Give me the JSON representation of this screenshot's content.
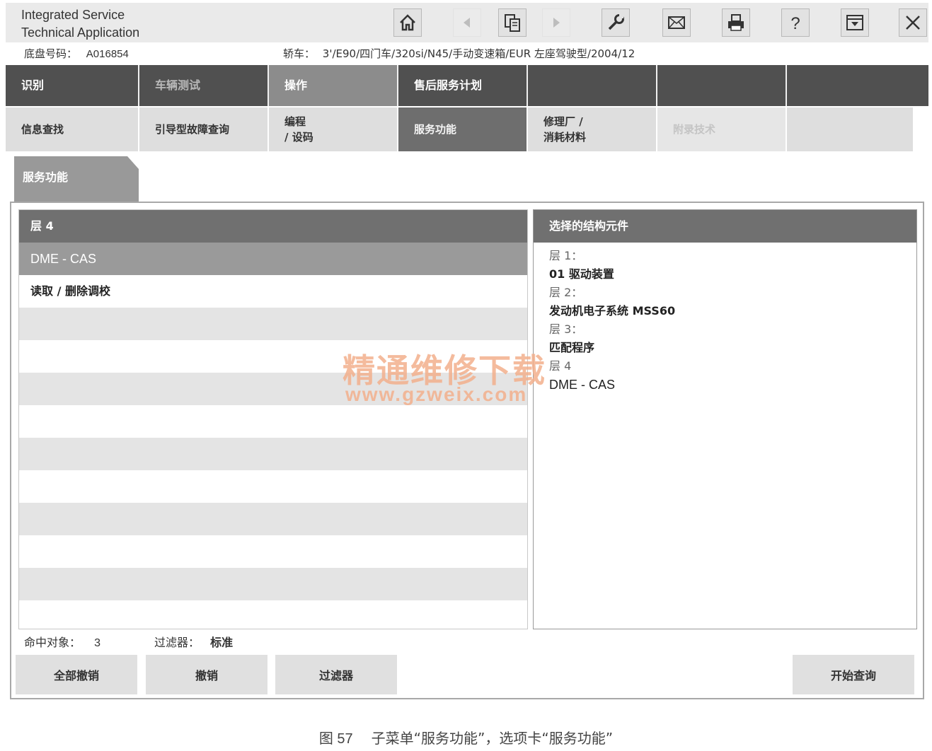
{
  "app": {
    "title_line1": "Integrated Service",
    "title_line2": "Technical Application"
  },
  "toolbar": [
    {
      "name": "home-icon",
      "enabled": true
    },
    {
      "name": "back-icon",
      "enabled": false
    },
    {
      "name": "document-icon",
      "enabled": true
    },
    {
      "name": "forward-icon",
      "enabled": false
    },
    {
      "name": "wrench-icon",
      "enabled": true
    },
    {
      "name": "mail-icon",
      "enabled": true
    },
    {
      "name": "print-icon",
      "enabled": true
    },
    {
      "name": "help-icon",
      "enabled": true
    },
    {
      "name": "minimize-icon",
      "enabled": true
    },
    {
      "name": "close-icon",
      "enabled": true
    }
  ],
  "info": {
    "chassis_label": "底盘号码：",
    "chassis_value": "A016854",
    "vehicle_label": "轿车：",
    "vehicle_value": "3'/E90/四门车/320si/N45/手动变速箱/EUR 左座驾驶型/2004/12"
  },
  "main_tabs": [
    {
      "label": "识别",
      "state": "normal"
    },
    {
      "label": "车辆测试",
      "state": "muted"
    },
    {
      "label": "操作",
      "state": "active"
    },
    {
      "label": "售后服务计划",
      "state": "normal"
    },
    {
      "label": "",
      "state": "normal"
    },
    {
      "label": "",
      "state": "normal"
    },
    {
      "label": "",
      "state": "normal"
    }
  ],
  "sub_tabs": [
    {
      "label": "信息查找",
      "state": "normal"
    },
    {
      "label": "引导型故障查询",
      "state": "normal"
    },
    {
      "label": "编程\n/ 设码",
      "state": "normal"
    },
    {
      "label": "服务功能",
      "state": "active"
    },
    {
      "label": "修理厂 /\n消耗材料",
      "state": "normal"
    },
    {
      "label": "附录技术",
      "state": "disabled"
    },
    {
      "label": "",
      "state": "normal"
    }
  ],
  "section_tab": "服务功能",
  "left_list": {
    "header": "层 4",
    "selected": "DME - CAS",
    "rows": [
      "读取 / 删除调校",
      "",
      "",
      "",
      "",
      "",
      "",
      "",
      "",
      ""
    ]
  },
  "right_box": {
    "header": "选择的结构元件",
    "tree": [
      {
        "text": "层 1：",
        "kind": "label"
      },
      {
        "text": "01 驱动装置",
        "kind": "value"
      },
      {
        "text": "层 2：",
        "kind": "label"
      },
      {
        "text": "发动机电子系统 MSS60",
        "kind": "value"
      },
      {
        "text": "层 3：",
        "kind": "label"
      },
      {
        "text": "匹配程序",
        "kind": "value"
      },
      {
        "text": "层 4",
        "kind": "label"
      },
      {
        "text": "DME - CAS",
        "kind": "value-latin"
      }
    ]
  },
  "status": {
    "hits_label": "命中对象：",
    "hits_value": "3",
    "filter_label": "过滤器：",
    "filter_value": "标准"
  },
  "buttons": {
    "deselect_all": "全部撤销",
    "deselect": "撤销",
    "filter": "过滤器",
    "start_query": "开始查询"
  },
  "watermark": {
    "line1": "精通维修下载",
    "line2": "www.gzweix.com"
  },
  "caption": {
    "number": "图 57",
    "text": "子菜单“服务功能”，选项卡“服务功能”"
  }
}
